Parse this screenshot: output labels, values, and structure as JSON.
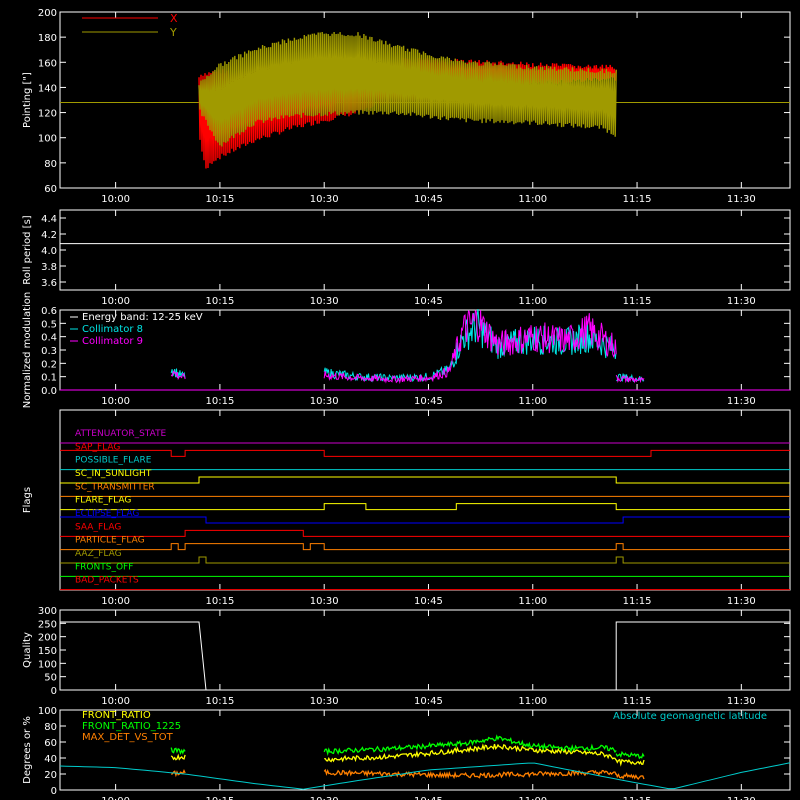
{
  "time_ticks": [
    "10:00",
    "10:15",
    "10:30",
    "10:45",
    "11:00",
    "11:15",
    "11:30"
  ],
  "chart_data": [
    {
      "type": "line",
      "panel": "pointing",
      "ylabel": "Pointing [\"]",
      "ylim": [
        60,
        200
      ],
      "yticks": [
        "60",
        "80",
        "100",
        "120",
        "140",
        "160",
        "180",
        "200"
      ],
      "xlim": [
        "09:52",
        "11:37"
      ],
      "series": [
        {
          "name": "X",
          "color": "#ff0000",
          "x": [
            "10:12",
            "10:13",
            "10:14",
            "10:17",
            "10:20",
            "10:25",
            "10:30",
            "10:40",
            "10:50",
            "11:00",
            "11:10",
            "11:12"
          ],
          "y_min": [
            100,
            72,
            80,
            88,
            96,
            105,
            112,
            125,
            135,
            140,
            145,
            145
          ],
          "y_max": [
            150,
            152,
            155,
            155,
            158,
            160,
            162,
            164,
            163,
            160,
            158,
            158
          ]
        },
        {
          "name": "Y",
          "color": "#a09a00",
          "x": [
            "10:12",
            "10:15",
            "10:20",
            "10:25",
            "10:30",
            "10:35",
            "10:40",
            "10:50",
            "11:00",
            "11:10",
            "11:12"
          ],
          "y_min": [
            120,
            92,
            110,
            115,
            117,
            118,
            118,
            112,
            110,
            106,
            100
          ],
          "y_max": [
            145,
            160,
            172,
            180,
            185,
            184,
            175,
            162,
            158,
            155,
            155
          ]
        }
      ],
      "reference_line": 128,
      "legend": "top-left"
    },
    {
      "type": "line",
      "panel": "roll-period",
      "ylabel": "Roll period [s]",
      "ylim": [
        3.5,
        4.5
      ],
      "yticks": [
        "3.6",
        "3.8",
        "4.0",
        "4.2",
        "4.4"
      ],
      "series": [
        {
          "color": "#ffffff",
          "x": [
            "09:52",
            "11:37"
          ],
          "y": [
            4.08,
            4.08
          ]
        }
      ]
    },
    {
      "type": "line",
      "panel": "modulation",
      "ylabel": "Normalized modulation",
      "ylim": [
        0,
        0.6
      ],
      "yticks": [
        "0.0",
        "0.1",
        "0.2",
        "0.3",
        "0.4",
        "0.5",
        "0.6"
      ],
      "legend_title": "Energy band: 12-25 keV",
      "series": [
        {
          "name": "Collimator 8",
          "color": "#00e5e5",
          "segments": [
            {
              "x": [
                "10:08",
                "10:09",
                "10:10"
              ],
              "y": [
                0.16,
                0.12,
                0.1
              ]
            },
            {
              "x": [
                "10:30",
                "10:35",
                "10:40",
                "10:45",
                "10:48",
                "10:50",
                "10:52",
                "10:55",
                "11:00",
                "11:05",
                "11:08",
                "11:12"
              ],
              "y": [
                0.13,
                0.1,
                0.09,
                0.1,
                0.15,
                0.4,
                0.48,
                0.33,
                0.38,
                0.36,
                0.4,
                0.3
              ]
            },
            {
              "x": [
                "11:12",
                "11:14",
                "11:16"
              ],
              "y": [
                0.1,
                0.09,
                0.08
              ]
            }
          ]
        },
        {
          "name": "Collimator 9",
          "color": "#ff00ff",
          "segments": [
            {
              "x": [
                "10:08",
                "10:09",
                "10:10"
              ],
              "y": [
                0.14,
                0.11,
                0.09
              ]
            },
            {
              "x": [
                "10:30",
                "10:35",
                "10:40",
                "10:45",
                "10:48",
                "10:50",
                "10:52",
                "10:55",
                "11:00",
                "11:05",
                "11:08",
                "11:12"
              ],
              "y": [
                0.11,
                0.09,
                0.08,
                0.09,
                0.14,
                0.45,
                0.52,
                0.34,
                0.4,
                0.37,
                0.45,
                0.32
              ]
            },
            {
              "x": [
                "11:12",
                "11:14",
                "11:16"
              ],
              "y": [
                0.09,
                0.08,
                0.07
              ]
            }
          ]
        }
      ]
    },
    {
      "type": "line",
      "panel": "flags",
      "ylabel": "Flags",
      "rows": [
        {
          "name": "ATTENUATOR_STATE",
          "color": "#cc00cc",
          "steps": [
            [
              "09:52",
              0
            ]
          ]
        },
        {
          "name": "SAP_FLAG",
          "color": "#ff0000",
          "steps": [
            [
              "09:52",
              1
            ],
            [
              "10:08",
              0
            ],
            [
              "10:10",
              1
            ],
            [
              "10:30",
              0
            ],
            [
              "11:17",
              1
            ]
          ]
        },
        {
          "name": "POSSIBLE_FLARE",
          "color": "#00cccc",
          "steps": [
            [
              "09:52",
              0
            ]
          ]
        },
        {
          "name": "SC_IN_SUNLIGHT",
          "color": "#ffff00",
          "steps": [
            [
              "09:52",
              0
            ],
            [
              "10:12",
              1
            ],
            [
              "11:12",
              0
            ]
          ]
        },
        {
          "name": "SC_TRANSMITTER",
          "color": "#ff8000",
          "steps": [
            [
              "09:52",
              0
            ]
          ]
        },
        {
          "name": "FLARE_FLAG",
          "color": "#ffff00",
          "steps": [
            [
              "09:52",
              0
            ],
            [
              "10:30",
              1
            ],
            [
              "10:36",
              0
            ],
            [
              "10:49",
              1
            ],
            [
              "11:12",
              0
            ]
          ]
        },
        {
          "name": "ECLIPSE_FLAG",
          "color": "#0000ff",
          "steps": [
            [
              "09:52",
              1
            ],
            [
              "10:13",
              0
            ],
            [
              "11:13",
              1
            ]
          ]
        },
        {
          "name": "SAA_FLAG",
          "color": "#ff0000",
          "steps": [
            [
              "09:52",
              0
            ],
            [
              "10:10",
              1
            ],
            [
              "10:27",
              0
            ]
          ]
        },
        {
          "name": "PARTICLE_FLAG",
          "color": "#ff8000",
          "steps": [
            [
              "09:52",
              0
            ],
            [
              "10:08",
              1
            ],
            [
              "10:09",
              0
            ],
            [
              "10:10",
              1
            ],
            [
              "10:27",
              0
            ],
            [
              "10:28",
              1
            ],
            [
              "10:30",
              0
            ],
            [
              "11:12",
              1
            ],
            [
              "11:13",
              0
            ]
          ]
        },
        {
          "name": "AAZ_FLAG",
          "color": "#a09a00",
          "steps": [
            [
              "09:52",
              0
            ],
            [
              "10:12",
              1
            ],
            [
              "10:13",
              0
            ],
            [
              "11:12",
              1
            ],
            [
              "11:13",
              0
            ]
          ]
        },
        {
          "name": "FRONTS_OFF",
          "color": "#00ff00",
          "steps": [
            [
              "09:52",
              0
            ]
          ]
        },
        {
          "name": "BAD_PACKETS",
          "color": "#ff0000",
          "steps": [
            [
              "09:52",
              0
            ]
          ]
        }
      ]
    },
    {
      "type": "line",
      "panel": "quality",
      "ylabel": "Quality",
      "ylim": [
        0,
        300
      ],
      "yticks": [
        "0",
        "50",
        "100",
        "150",
        "200",
        "250",
        "300"
      ],
      "series": [
        {
          "color": "#ffffff",
          "x": [
            "09:52",
            "10:12",
            "10:13",
            "11:12",
            "11:12",
            "11:37"
          ],
          "y": [
            255,
            255,
            0,
            0,
            255,
            255
          ]
        }
      ]
    },
    {
      "type": "line",
      "panel": "ratios",
      "ylabel": "Degrees or %",
      "ylim": [
        0,
        100
      ],
      "yticks": [
        "0",
        "20",
        "40",
        "60",
        "80",
        "100"
      ],
      "series": [
        {
          "name": "FRONT_RATIO",
          "color": "#ffff00",
          "segments": [
            {
              "x": [
                "10:08",
                "10:10"
              ],
              "y": [
                40,
                42
              ]
            },
            {
              "x": [
                "10:30",
                "10:40",
                "10:50",
                "10:55",
                "11:00",
                "11:05",
                "11:10",
                "11:12"
              ],
              "y": [
                38,
                42,
                50,
                55,
                50,
                48,
                45,
                40
              ]
            },
            {
              "x": [
                "11:12",
                "11:16"
              ],
              "y": [
                35,
                35
              ]
            }
          ]
        },
        {
          "name": "FRONT_RATIO_1225",
          "color": "#00ff00",
          "segments": [
            {
              "x": [
                "10:08",
                "10:10"
              ],
              "y": [
                50,
                48
              ]
            },
            {
              "x": [
                "10:30",
                "10:40",
                "10:50",
                "10:55",
                "11:00",
                "11:05",
                "11:10",
                "11:12"
              ],
              "y": [
                48,
                52,
                58,
                65,
                55,
                52,
                53,
                50
              ]
            },
            {
              "x": [
                "11:12",
                "11:16"
              ],
              "y": [
                45,
                42
              ]
            }
          ]
        },
        {
          "name": "MAX_DET_VS_TOT",
          "color": "#ff8000",
          "segments": [
            {
              "x": [
                "10:08",
                "10:10"
              ],
              "y": [
                20,
                22
              ]
            },
            {
              "x": [
                "10:30",
                "10:40",
                "10:50",
                "11:00",
                "11:10",
                "11:12"
              ],
              "y": [
                22,
                20,
                18,
                20,
                22,
                20
              ]
            },
            {
              "x": [
                "11:12",
                "11:16"
              ],
              "y": [
                18,
                16
              ]
            }
          ]
        },
        {
          "name": "Absolute geomagnetic latitude",
          "color": "#00cccc",
          "x": [
            "09:52",
            "10:00",
            "10:10",
            "10:20",
            "10:27",
            "10:35",
            "10:45",
            "11:00",
            "11:13",
            "11:20",
            "11:30",
            "11:37"
          ],
          "y": [
            30,
            28,
            20,
            8,
            1,
            12,
            25,
            34,
            12,
            1,
            22,
            34
          ]
        }
      ]
    }
  ]
}
